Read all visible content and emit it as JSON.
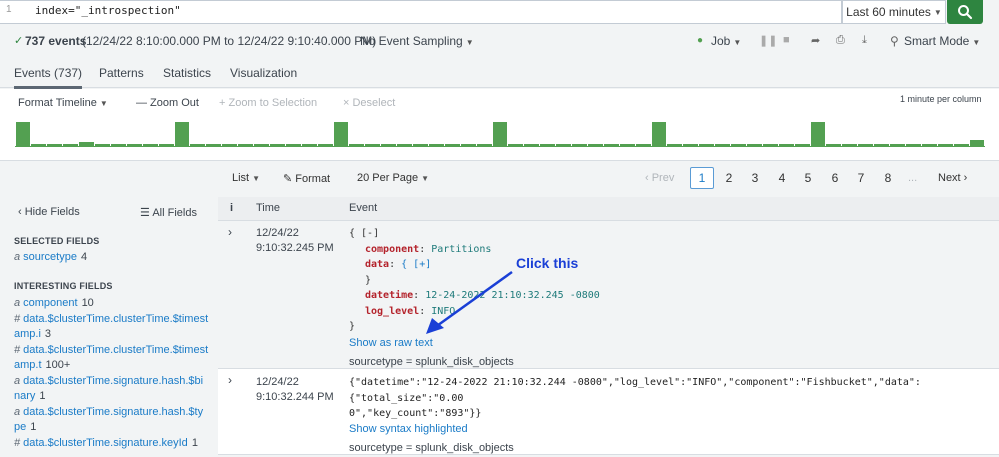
{
  "search": {
    "line_number": "1",
    "query": "index=\"_introspection\"",
    "time_range": "Last 60 minutes"
  },
  "status": {
    "events_count": "737 events",
    "time_span": "(12/24/22 8:10:00.000 PM to 12/24/22 9:10:40.000 PM)",
    "sampling": "No Event Sampling",
    "job": "Job",
    "mode": "Smart Mode"
  },
  "tabs": [
    "Events (737)",
    "Patterns",
    "Statistics",
    "Visualization"
  ],
  "timeline": {
    "format": "Format Timeline",
    "zoom_out": "— Zoom Out",
    "zoom_selection": "+ Zoom to Selection",
    "deselect": "× Deselect",
    "scale": "1 minute per column",
    "bars": [
      20,
      2,
      2,
      2,
      3,
      2,
      2,
      2,
      2,
      2,
      20,
      2,
      2,
      2,
      2,
      2,
      2,
      2,
      2,
      2,
      20,
      2,
      2,
      2,
      2,
      2,
      2,
      2,
      2,
      2,
      20,
      2,
      2,
      2,
      2,
      2,
      2,
      2,
      2,
      2,
      20,
      2,
      2,
      2,
      2,
      2,
      2,
      2,
      2,
      2,
      20,
      2,
      2,
      2,
      2,
      2,
      2,
      2,
      2,
      2,
      5
    ]
  },
  "pager": {
    "list": "List",
    "format": "Format",
    "per_page": "20 Per Page",
    "prev": "‹ Prev",
    "pages": [
      "1",
      "2",
      "3",
      "4",
      "5",
      "6",
      "7",
      "8"
    ],
    "ellipsis": "...",
    "next": "Next ›"
  },
  "sidebar": {
    "hide_fields": "‹ Hide Fields",
    "all_fields": "All Fields",
    "selected_heading": "SELECTED FIELDS",
    "selected": [
      {
        "type": "a",
        "name": "sourcetype",
        "count": "4"
      }
    ],
    "interesting_heading": "INTERESTING FIELDS",
    "interesting": [
      {
        "type": "a",
        "name": "component",
        "count": "10"
      },
      {
        "type": "#",
        "name": "data.$clusterTime.clusterTime.$timestamp.i",
        "count": "3"
      },
      {
        "type": "#",
        "name": "data.$clusterTime.clusterTime.$timestamp.t",
        "count": "100+"
      },
      {
        "type": "a",
        "name": "data.$clusterTime.signature.hash.$binary",
        "count": "1"
      },
      {
        "type": "a",
        "name": "data.$clusterTime.signature.hash.$type",
        "count": "1"
      },
      {
        "type": "#",
        "name": "data.$clusterTime.signature.keyId",
        "count": "1"
      }
    ]
  },
  "events": {
    "header": {
      "info": "i",
      "time": "Time",
      "event": "Event"
    },
    "rows": [
      {
        "date": "12/24/22",
        "time": "9:10:32.245 PM",
        "open_brace": "{ [-]",
        "fields": [
          {
            "key": "component",
            "value": "Partitions"
          },
          {
            "key": "data",
            "value": "{ [+]"
          },
          {
            "key": "",
            "value": "}"
          },
          {
            "key": "datetime",
            "value": "12-24-2022 21:10:32.245 -0800"
          },
          {
            "key": "log_level",
            "value": "INFO"
          }
        ],
        "close_brace": "}",
        "toggle_link": "Show as raw text",
        "sourcetype": "sourcetype = splunk_disk_objects"
      },
      {
        "date": "12/24/22",
        "time": "9:10:32.244 PM",
        "raw_line1": "{\"datetime\":\"12-24-2022 21:10:32.244 -0800\",\"log_level\":\"INFO\",\"component\":\"Fishbucket\",\"data\":{\"total_size\":\"0.00",
        "raw_line2": "0\",\"key_count\":\"893\"}}",
        "toggle_link": "Show syntax highlighted",
        "sourcetype": "sourcetype = splunk_disk_objects"
      }
    ]
  },
  "annotation": {
    "text": "Click this"
  },
  "colors": {
    "accent_green": "#53a051",
    "link_blue": "#1a7bc7",
    "annotation_blue": "#1a3fd6"
  }
}
